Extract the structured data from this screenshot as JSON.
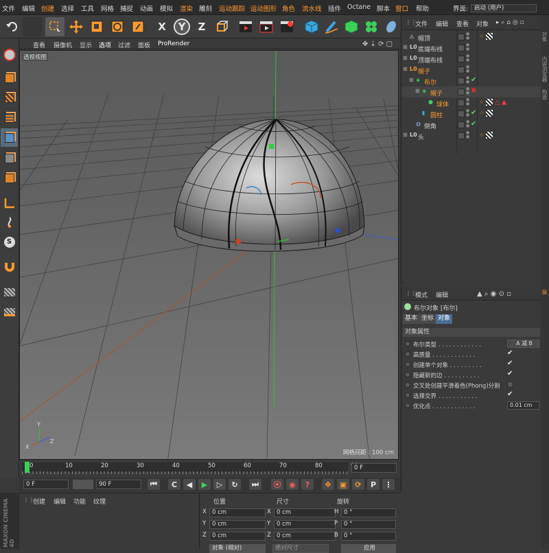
{
  "menu": {
    "items": [
      "文件",
      "编辑",
      "创建",
      "选择",
      "工具",
      "网格",
      "捕捉",
      "动画",
      "模拟",
      "渲染",
      "雕刻",
      "运动跟踪",
      "运动图形",
      "角色",
      "流水线",
      "插件",
      "Octane",
      "脚本",
      "窗口",
      "帮助"
    ],
    "layout_label": "界面:",
    "layout_value": "启动 (用户)"
  },
  "toolbar": {
    "axis_x": "X",
    "axis_y": "Y",
    "axis_z": "Z"
  },
  "viewport": {
    "menu": [
      "查看",
      "摄像机",
      "显示",
      "选项",
      "过滤",
      "面板",
      "ProRender"
    ],
    "label": "透视视图",
    "grid_info": "网格间距 : 100 cm",
    "axis_labels": {
      "y": "Y",
      "z": "Z",
      "x": "X"
    }
  },
  "objects": {
    "menu": [
      "文件",
      "编辑",
      "查看",
      "对象"
    ],
    "rows": [
      {
        "name": "帽顶",
        "color": "#d0d0d0",
        "indent": 0
      },
      {
        "name": "底端布线",
        "color": "#d0d0d0",
        "indent": 0
      },
      {
        "name": "顶端布线",
        "color": "#d0d0d0",
        "indent": 0
      },
      {
        "name": "帽子",
        "color": "#ff9a2e",
        "indent": 0
      },
      {
        "name": "布尔",
        "color": "#ff9a2e",
        "indent": 1
      },
      {
        "name": "帽子",
        "color": "#ff9a2e",
        "indent": 2
      },
      {
        "name": "球体",
        "color": "#ff9a2e",
        "indent": 3
      },
      {
        "name": "圆柱",
        "color": "#ff9a2e",
        "indent": 2
      },
      {
        "name": "倒角",
        "color": "#d0d0d0",
        "indent": 1
      },
      {
        "name": "头",
        "color": "#d0d0d0",
        "indent": 0
      }
    ]
  },
  "attributes": {
    "menu": [
      "模式",
      "编辑"
    ],
    "object_title": "布尔对象 [布尔]",
    "tabs": [
      "基本",
      "坐标",
      "对象"
    ],
    "active_tab": "对象",
    "section": "对象属性",
    "rows": [
      {
        "label": "布尔类型 . . . . . . . . . . . .",
        "type": "value",
        "value": "A 减 B"
      },
      {
        "label": "高质量 . . . . . . . . . . . .",
        "type": "check",
        "value": "✔"
      },
      {
        "label": "创建单个对象 . . . . . . . . .",
        "type": "check",
        "value": "✔"
      },
      {
        "label": "隐藏新的边 . . . . . . . . . .",
        "type": "check",
        "value": "✔"
      },
      {
        "label": "交叉处创建平滑着色(Phong)分割",
        "type": "box",
        "value": ""
      },
      {
        "label": "选择交界 . . . . . . . . . . .",
        "type": "check",
        "value": "✔"
      },
      {
        "label": "优化点 . . . . . . . . . . . .",
        "type": "value",
        "value": "0.01 cm"
      }
    ]
  },
  "timeline": {
    "ticks": [
      "0",
      "10",
      "20",
      "30",
      "40",
      "50",
      "60",
      "70",
      "80",
      "90"
    ],
    "current_frame": "0 F",
    "start": "0 F",
    "end": "90 F"
  },
  "materials": {
    "menu": [
      "创建",
      "编辑",
      "功能",
      "纹理"
    ],
    "brand": "MAXON CINEMA 4D"
  },
  "coordinates": {
    "headers": [
      "位置",
      "尺寸",
      "旋转"
    ],
    "rows": [
      {
        "axis": "X",
        "pos": "0 cm",
        "size": "0 cm",
        "rot_axis": "H",
        "rot": "0 °"
      },
      {
        "axis": "Y",
        "pos": "0 cm",
        "size": "0 cm",
        "rot_axis": "P",
        "rot": "0 °"
      },
      {
        "axis": "Z",
        "pos": "0 cm",
        "size": "0 cm",
        "rot_axis": "B",
        "rot": "0 °"
      }
    ],
    "mode": "对象 (相对)",
    "size_mode": "绝对尺寸",
    "apply": "应用"
  },
  "right_strip": [
    "对象",
    "内容浏览器",
    "构造",
    "层"
  ],
  "colors": {
    "accent": "#ff9a2e",
    "tab_active": "#4a6d95",
    "check": "#5cd65c"
  }
}
